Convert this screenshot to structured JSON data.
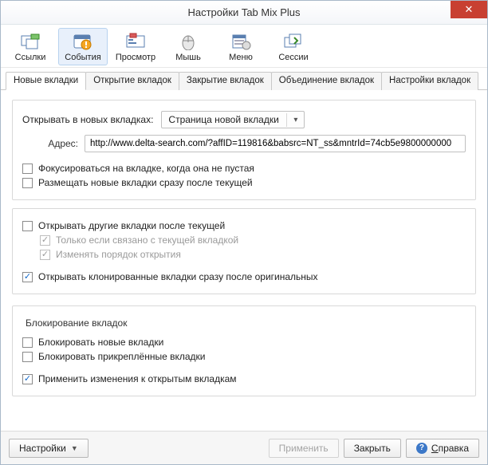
{
  "window": {
    "title": "Настройки Tab Mix Plus"
  },
  "toolbar": {
    "items": [
      {
        "id": "links",
        "label": "Ссылки",
        "selected": false
      },
      {
        "id": "events",
        "label": "События",
        "selected": true
      },
      {
        "id": "display",
        "label": "Просмотр",
        "selected": false
      },
      {
        "id": "mouse",
        "label": "Мышь",
        "selected": false
      },
      {
        "id": "menu",
        "label": "Меню",
        "selected": false
      },
      {
        "id": "session",
        "label": "Сессии",
        "selected": false
      }
    ]
  },
  "tabs": [
    {
      "id": "new",
      "label": "Новые вкладки",
      "active": true
    },
    {
      "id": "open",
      "label": "Открытие вкладок",
      "active": false
    },
    {
      "id": "close",
      "label": "Закрытие вкладок",
      "active": false
    },
    {
      "id": "merge",
      "label": "Объединение вкладок",
      "active": false
    },
    {
      "id": "tabset",
      "label": "Настройки вкладок",
      "active": false
    }
  ],
  "form": {
    "open_in_label": "Открывать в новых вкладках:",
    "open_in_select": {
      "value": "Страница новой вкладки"
    },
    "address_label": "Адрес:",
    "address_value": "http://www.delta-search.com/?affID=119816&babsrc=NT_ss&mntrId=74cb5e9800000000",
    "focus_nonempty": {
      "label": "Фокусироваться на вкладке, когда она не пустая",
      "checked": false
    },
    "place_after_current": {
      "label": "Размещать новые вкладки сразу после текущей",
      "checked": false
    },
    "open_other_after_current": {
      "label": "Открывать другие вкладки после текущей",
      "checked": false
    },
    "only_if_related": {
      "label": "Только если связано с текущей вкладкой",
      "checked": true,
      "disabled": true
    },
    "change_open_order": {
      "label": "Изменять порядок открытия",
      "checked": true,
      "disabled": true
    },
    "open_cloned_after_orig": {
      "label": "Открывать клонированные вкладки сразу после оригинальных",
      "checked": true
    },
    "locking_legend": "Блокирование вкладок",
    "lock_new": {
      "label": "Блокировать новые вкладки",
      "checked": false
    },
    "lock_pinned": {
      "label": "Блокировать прикреплённые вкладки",
      "checked": false
    },
    "apply_to_open": {
      "label": "Применить изменения к открытым вкладкам",
      "checked": true
    }
  },
  "footer": {
    "settings_menu": "Настройки",
    "apply": "Применить",
    "close": "Закрыть",
    "help_label": "правка",
    "help_accesskey": "С"
  }
}
